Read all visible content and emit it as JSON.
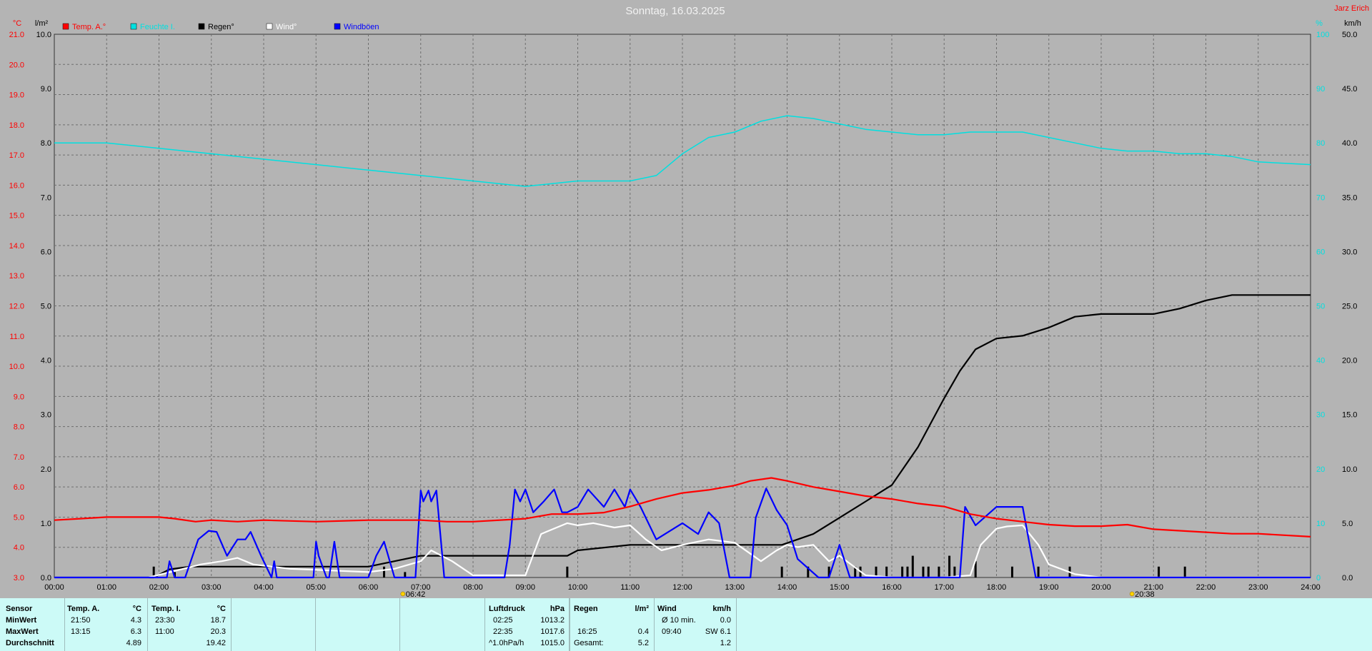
{
  "title": "Sonntag, 16.03.2025",
  "station": "Jarz Erich",
  "colors": {
    "temp": "#ff0000",
    "humidity": "#00e0e0",
    "rain": "#000000",
    "wind": "#ffffff",
    "gusts": "#0000ff",
    "grid": "#6e6e6e"
  },
  "chart_data": {
    "type": "line",
    "title": "Sonntag, 16.03.2025",
    "x_unit": "hours",
    "xlim": [
      0,
      24
    ],
    "x_ticks": [
      "00:00",
      "01:00",
      "02:00",
      "03:00",
      "04:00",
      "05:00",
      "06:00",
      "07:00",
      "08:00",
      "09:00",
      "10:00",
      "11:00",
      "12:00",
      "13:00",
      "14:00",
      "15:00",
      "16:00",
      "17:00",
      "18:00",
      "19:00",
      "20:00",
      "21:00",
      "22:00",
      "23:00",
      "24:00"
    ],
    "axes": {
      "temp": {
        "unit": "°C",
        "range": [
          3.0,
          21.0
        ],
        "ticks": [
          "21.0",
          "20.0",
          "19.0",
          "18.0",
          "17.0",
          "16.0",
          "15.0",
          "14.0",
          "13.0",
          "12.0",
          "11.0",
          "10.0",
          "9.0",
          "8.0",
          "7.0",
          "6.0",
          "5.0",
          "4.0",
          "3.0"
        ]
      },
      "rain": {
        "unit": "l/m²",
        "range": [
          0.0,
          10.0
        ],
        "ticks": [
          "10.0",
          "9.0",
          "8.0",
          "7.0",
          "6.0",
          "5.0",
          "4.0",
          "3.0",
          "2.0",
          "1.0",
          "0.0"
        ]
      },
      "humidity": {
        "unit": "%",
        "range": [
          0,
          100
        ],
        "ticks": [
          "100",
          "90",
          "80",
          "70",
          "60",
          "50",
          "40",
          "30",
          "20",
          "10",
          "0"
        ]
      },
      "wind": {
        "unit": "km/h",
        "range": [
          0.0,
          50.0
        ],
        "ticks": [
          "50.0",
          "45.0",
          "40.0",
          "35.0",
          "30.0",
          "25.0",
          "20.0",
          "15.0",
          "10.0",
          "5.0",
          "0.0"
        ]
      }
    },
    "grid": true,
    "legend_position": "top-left",
    "series": [
      {
        "name": "Temp. A.°",
        "axis": "temp",
        "color": "#ff0000",
        "x": [
          0,
          0.5,
          1,
          1.5,
          2,
          2.3,
          2.7,
          3,
          3.5,
          4,
          5,
          6,
          6.5,
          7,
          7.5,
          8,
          9,
          9.5,
          10,
          10.5,
          11,
          11.5,
          12,
          12.5,
          13,
          13.3,
          13.7,
          14,
          14.5,
          15,
          15.5,
          16,
          16.5,
          17,
          17.5,
          18,
          18.5,
          19,
          19.5,
          20,
          20.5,
          21,
          21.5,
          22,
          22.5,
          23,
          24
        ],
        "y": [
          4.9,
          4.95,
          5.0,
          5.0,
          5.0,
          4.95,
          4.85,
          4.9,
          4.85,
          4.9,
          4.85,
          4.9,
          4.9,
          4.9,
          4.85,
          4.85,
          4.95,
          5.1,
          5.1,
          5.15,
          5.35,
          5.6,
          5.8,
          5.9,
          6.05,
          6.2,
          6.3,
          6.2,
          6.0,
          5.85,
          5.7,
          5.6,
          5.45,
          5.35,
          5.1,
          4.95,
          4.85,
          4.75,
          4.7,
          4.7,
          4.75,
          4.6,
          4.55,
          4.5,
          4.45,
          4.45,
          4.35
        ]
      },
      {
        "name": "Feuchte I.",
        "axis": "humidity",
        "color": "#00e0e0",
        "x": [
          0,
          1,
          2,
          3,
          4,
          5,
          6,
          7,
          8,
          9,
          10,
          11,
          11.5,
          12,
          12.5,
          13,
          13.5,
          14,
          14.5,
          15,
          15.5,
          16,
          16.5,
          17,
          17.5,
          18,
          18.5,
          19,
          19.5,
          20,
          20.5,
          21,
          21.5,
          22,
          22.5,
          23,
          24
        ],
        "y": [
          80,
          80,
          79,
          78,
          77,
          76,
          75,
          74,
          73,
          72,
          73,
          73,
          74,
          78,
          81,
          82,
          84,
          85,
          84.5,
          83.5,
          82.5,
          82,
          81.5,
          81.5,
          82,
          82,
          82,
          81,
          80,
          79,
          78.5,
          78.5,
          78,
          78,
          77.5,
          76.5,
          76
        ]
      },
      {
        "name": "Regen°",
        "axis": "rain",
        "color": "#000000",
        "x": [
          0,
          1,
          1.9,
          2.2,
          2.6,
          3,
          4,
          5,
          6,
          6.5,
          7,
          7.5,
          8,
          9,
          9.8,
          10,
          11,
          12,
          13,
          13.9,
          14.5,
          15,
          15.5,
          16,
          16.5,
          17,
          17.3,
          17.6,
          18,
          18.5,
          19,
          19.5,
          20,
          20.5,
          21,
          21.5,
          22,
          22.5,
          23,
          24
        ],
        "y": [
          0,
          0,
          0,
          0.15,
          0.2,
          0.2,
          0.2,
          0.2,
          0.2,
          0.3,
          0.4,
          0.4,
          0.4,
          0.4,
          0.4,
          0.5,
          0.6,
          0.6,
          0.6,
          0.6,
          0.8,
          1.1,
          1.4,
          1.7,
          2.4,
          3.3,
          3.8,
          4.2,
          4.4,
          4.45,
          4.6,
          4.8,
          4.85,
          4.85,
          4.85,
          4.95,
          5.1,
          5.2,
          5.2,
          5.2
        ]
      },
      {
        "name": "Wind°",
        "axis": "wind",
        "color": "#ffffff",
        "x": [
          0,
          1.8,
          2.8,
          3.2,
          3.5,
          3.8,
          4.5,
          5,
          6,
          6.5,
          7,
          7.2,
          7.6,
          8,
          9,
          9.3,
          9.8,
          10,
          10.3,
          10.7,
          11,
          11.3,
          11.6,
          12,
          12.5,
          13,
          13.5,
          13.8,
          14,
          14.2,
          14.5,
          14.8,
          15,
          15.5,
          16,
          17,
          17.5,
          17.7,
          18,
          18.2,
          18.5,
          18.8,
          19,
          19.5,
          20,
          24
        ],
        "y": [
          0,
          0,
          1.2,
          1.5,
          1.8,
          1.2,
          0.8,
          0.7,
          0.5,
          0.8,
          1.5,
          2.5,
          1.5,
          0.2,
          0.2,
          4,
          5,
          4.8,
          5,
          4.6,
          4.8,
          3.5,
          2.5,
          3,
          3.5,
          3.2,
          1.5,
          2.5,
          3,
          2.8,
          3,
          1.5,
          2,
          0.2,
          0,
          0,
          0.2,
          3,
          4.5,
          4.7,
          4.8,
          3,
          1.2,
          0.3,
          0,
          0
        ]
      },
      {
        "name": "Windböen",
        "axis": "wind",
        "color": "#0000ff",
        "x": [
          0,
          2.15,
          2.2,
          2.3,
          2.5,
          2.75,
          2.95,
          3.1,
          3.3,
          3.5,
          3.65,
          3.75,
          3.95,
          4.15,
          4.2,
          4.25,
          4.3,
          4.5,
          4.95,
          5.0,
          5.05,
          5.2,
          5.25,
          5.35,
          5.45,
          6.0,
          6.15,
          6.3,
          6.5,
          6.9,
          7.0,
          7.05,
          7.15,
          7.2,
          7.3,
          7.45,
          8.6,
          8.7,
          8.8,
          8.9,
          9.0,
          9.15,
          9.35,
          9.55,
          9.7,
          9.8,
          10.0,
          10.2,
          10.5,
          10.7,
          10.9,
          11.0,
          11.2,
          11.5,
          12.0,
          12.3,
          12.5,
          12.6,
          12.7,
          12.9,
          13.3,
          13.4,
          13.6,
          13.8,
          14.0,
          14.2,
          14.6,
          14.8,
          15.0,
          15.2,
          15.5,
          17.3,
          17.4,
          17.6,
          18.0,
          18.2,
          18.5,
          18.75,
          18.9,
          19.1,
          19.3,
          24
        ],
        "y": [
          0,
          0,
          1.5,
          0,
          0,
          3.5,
          4.3,
          4.2,
          2,
          3.5,
          3.5,
          4.2,
          2,
          0,
          1.5,
          0,
          0,
          0,
          0,
          3.3,
          2,
          0,
          0,
          3.3,
          0,
          0,
          2,
          3.3,
          0,
          0,
          8,
          7,
          8,
          7,
          8,
          0,
          0,
          3,
          8.1,
          7,
          8.1,
          6,
          7,
          8.1,
          6,
          6,
          6.5,
          8.1,
          6.5,
          8.1,
          6.5,
          8.1,
          6.5,
          3.5,
          5,
          4,
          6,
          5.5,
          5,
          0,
          0,
          5.5,
          8.2,
          6.2,
          4.8,
          1.7,
          0,
          0,
          3,
          0,
          0,
          0,
          6.5,
          4.8,
          6.5,
          6.5,
          6.5,
          0,
          0,
          0,
          0,
          0
        ]
      }
    ],
    "rain_bars": {
      "x": [
        1.9,
        2.3,
        6.3,
        6.7,
        9.8,
        13.9,
        14.4,
        14.8,
        15.3,
        15.4,
        15.7,
        15.9,
        16.2,
        16.3,
        16.4,
        16.6,
        16.7,
        16.9,
        17.1,
        17.2,
        17.6,
        18.3,
        18.8,
        19.4,
        21.1,
        21.6
      ],
      "y": [
        0.2,
        0.1,
        0.2,
        0.1,
        0.2,
        0.2,
        0.2,
        0.2,
        0.2,
        0.2,
        0.2,
        0.2,
        0.2,
        0.2,
        0.4,
        0.2,
        0.2,
        0.2,
        0.4,
        0.2,
        0.3,
        0.2,
        0.2,
        0.2,
        0.2,
        0.2
      ]
    },
    "sun_markers": [
      {
        "label": "06:42",
        "x": 6.7
      },
      {
        "label": "20:38",
        "x": 20.63
      }
    ]
  },
  "legend": [
    {
      "name": "Temp. A.°",
      "color": "#ff0000"
    },
    {
      "name": "Feuchte I.",
      "color": "#00e0e0"
    },
    {
      "name": "Regen°",
      "color": "#000000"
    },
    {
      "name": "Wind°",
      "color": "#ffffff"
    },
    {
      "name": "Windböen",
      "color": "#0000ff"
    }
  ],
  "stats": {
    "row_labels": [
      "Sensor",
      "MinWert",
      "MaxWert",
      "Durchschnitt"
    ],
    "temp_a": {
      "title": "Temp. A.",
      "unit": "°C",
      "min_time": "21:50",
      "min": "4.3",
      "max_time": "13:15",
      "max": "6.3",
      "avg": "4.89"
    },
    "temp_i": {
      "title": "Temp. I.",
      "unit": "°C",
      "min_time": "23:30",
      "min": "18.7",
      "max_time": "11:00",
      "max": "20.3",
      "avg": "19.42"
    },
    "pressure": {
      "title": "Luftdruck",
      "unit": "hPa",
      "min_time": "02:25",
      "min": "1013.2",
      "max_time": "22:35",
      "max": "1017.6",
      "trend_label": "^1.0hPa/h",
      "avg": "1015.0"
    },
    "rain": {
      "title": "Regen",
      "unit": "l/m²",
      "max_time": "16:25",
      "max": "0.4",
      "total_label": "Gesamt:",
      "total": "5.2"
    },
    "wind": {
      "title": "Wind",
      "unit": "km/h",
      "avg10_label": "Ø 10 min.",
      "avg10": "0.0",
      "max_time": "09:40",
      "max": "SW 6.1",
      "avg": "1.2"
    }
  }
}
